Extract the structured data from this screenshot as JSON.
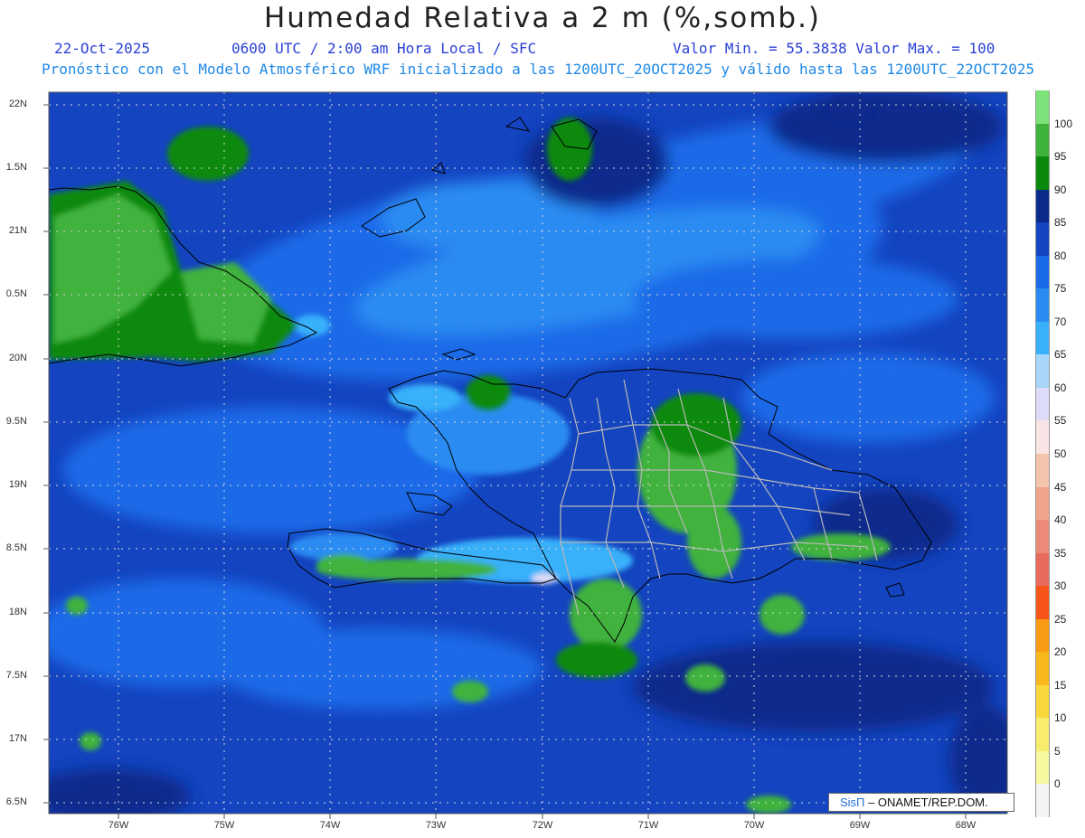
{
  "title": "Humedad Relativa a 2 m (%,somb.)",
  "header": {
    "date": "22-Oct-2025",
    "time": "0600 UTC / 2:00 am Hora Local / SFC",
    "minmax": "Valor Min. = 55.3838  Valor Max. = 100",
    "model_line": "Pronóstico con el Modelo Atmosférico WRF inicializado a las 1200UTC_20OCT2025 y válido hasta las  1200UTC_22OCT2025"
  },
  "axes": {
    "lat_labels": [
      "22N",
      "1.5N",
      "21N",
      "0.5N",
      "20N",
      "9.5N",
      "19N",
      "8.5N",
      "18N",
      "7.5N",
      "17N",
      "6.5N"
    ],
    "lon_labels": [
      "76W",
      "75W",
      "74W",
      "73W",
      "72W",
      "71W",
      "70W",
      "69W",
      "68W"
    ]
  },
  "colorbar": {
    "labels": [
      "100",
      "95",
      "90",
      "85",
      "80",
      "75",
      "70",
      "65",
      "60",
      "55",
      "50",
      "45",
      "40",
      "35",
      "30",
      "25",
      "20",
      "15",
      "10",
      "5",
      "0"
    ],
    "colors": [
      "#7de27a",
      "#3fb23c",
      "#0a8a0a",
      "#0a2a8c",
      "#1444c0",
      "#1a6ae8",
      "#2a8cf2",
      "#38b0fa",
      "#a8d6fa",
      "#dcdcf8",
      "#f8e4e4",
      "#f4c4ac",
      "#f0a48c",
      "#ec8a78",
      "#e86a5c",
      "#f85418",
      "#f89a14",
      "#f8b81c",
      "#f8d83c",
      "#f8ec6c",
      "#f8f8a0",
      "#f4f4f4"
    ]
  },
  "credit": {
    "sis": "SisΠ",
    "org": "– ONAMET/REP.DOM."
  }
}
